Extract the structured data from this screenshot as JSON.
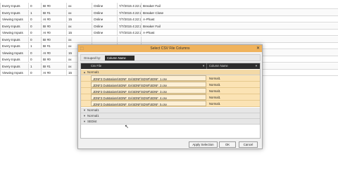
{
  "background_rows": [
    {
      "c1": "Every Inputs",
      "c2": "0",
      "c3": "BI #0",
      "c4": "xx",
      "c5": "Online",
      "c6": "7/7/2015 4:22:29 PM",
      "c7": "Breaker Fail"
    },
    {
      "c1": "Every Inputs",
      "c2": "1",
      "c3": "BI #1",
      "c4": "xx",
      "c5": "Online",
      "c6": "7/7/2015 4:22:29 PM",
      "c7": "Breaker Close"
    },
    {
      "c1": "Viewing Inputs",
      "c2": "0",
      "c3": "AI #0",
      "c4": "15",
      "c5": "Online",
      "c6": "7/7/2015 4:22:29 PM",
      "c7": "A-Phast"
    },
    {
      "c1": "Every Inputs",
      "c2": "0",
      "c3": "BI #0",
      "c4": "xx",
      "c5": "Online",
      "c6": "7/7/2015 4:22:29 PM",
      "c7": "Breaker Fail"
    },
    {
      "c1": "Viewing Inputs",
      "c2": "0",
      "c3": "AI #0",
      "c4": "15",
      "c5": "Online",
      "c6": "7/7/2015 4:22:29 PM",
      "c7": "A-Phast"
    },
    {
      "c1": "Every Inputs",
      "c2": "0",
      "c3": "BI #0",
      "c4": "xx",
      "c5": "",
      "c6": "",
      "c7": ""
    },
    {
      "c1": "Every Inputs",
      "c2": "1",
      "c3": "BI #1",
      "c4": "xx",
      "c5": "",
      "c6": "",
      "c7": ""
    },
    {
      "c1": "Viewing Inputs",
      "c2": "0",
      "c3": "AI #0",
      "c4": "15",
      "c5": "",
      "c6": "",
      "c7": ""
    },
    {
      "c1": "Every Inputs",
      "c2": "0",
      "c3": "BI #0",
      "c4": "xx",
      "c5": "",
      "c6": "",
      "c7": ""
    },
    {
      "c1": "Every Inputs",
      "c2": "1",
      "c3": "BI #1",
      "c4": "xx",
      "c5": "",
      "c6": "",
      "c7": ""
    },
    {
      "c1": "Viewing Inputs",
      "c2": "0",
      "c3": "AI #0",
      "c4": "15",
      "c5": "",
      "c6": "",
      "c7": ""
    }
  ],
  "dialog": {
    "title": "Select CSV File Columns",
    "icon": "app-icon",
    "close_glyph": "✕",
    "group_by_label": "Grouped by:",
    "group_chip": "Column Name",
    "col_file": "Csv File",
    "col_name": "Column Name",
    "groups": [
      {
        "label": "Normal1",
        "expanded": true
      },
      {
        "label": "Normal1",
        "expanded": false
      },
      {
        "label": "Normal1",
        "expanded": false
      },
      {
        "label": "SEDist",
        "expanded": false
      }
    ],
    "rows": [
      {
        "file": "JDNF3 Outstations\\SDNF_Ev\\SDNF\\SDNF\\SDNF_1.csv",
        "col": "Normal1"
      },
      {
        "file": "JDNF3 Outstations\\SDNF_Ev\\SDNF\\SDNF\\SDNF_2.csv",
        "col": "Normal1"
      },
      {
        "file": "JDNF3 Outstations\\SDNF_Ev\\SDNF\\SDNF\\SDNF_3.csv",
        "col": "Normal1"
      },
      {
        "file": "JDNF3 Outstations\\SDNF_Ev\\SDNF\\SDNF\\SDNF_4.csv",
        "col": "Normal1"
      },
      {
        "file": "JDNF3 Outstations\\SDNF_Ev\\SDNF\\SDNF\\SDNF_5.csv",
        "col": "Normal1"
      }
    ],
    "buttons": {
      "apply": "Apply Selection",
      "ok": "OK",
      "cancel": "Cancel"
    }
  },
  "colors": {
    "accent": "#f0b35c",
    "row": "#fbe3b4",
    "header": "#2d2d2d"
  }
}
